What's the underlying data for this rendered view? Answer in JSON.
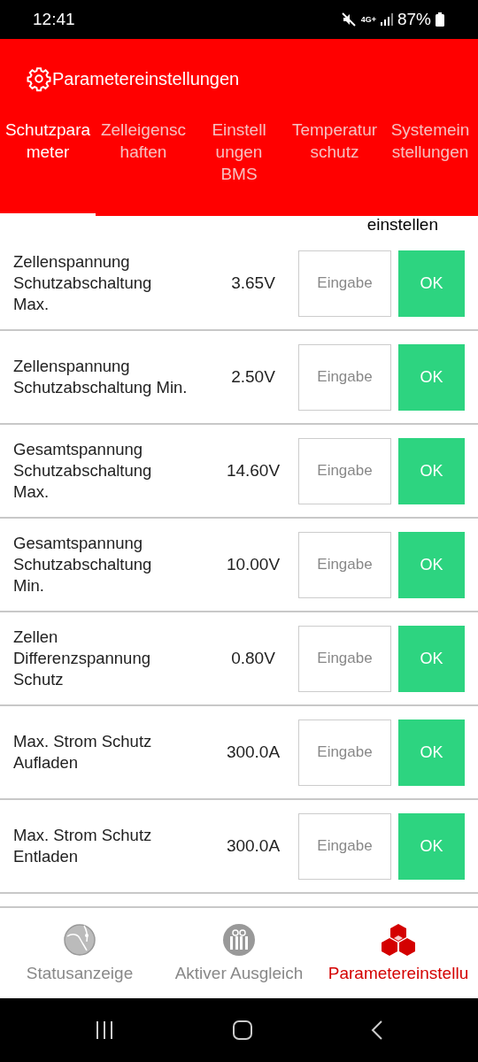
{
  "status_bar": {
    "time": "12:41",
    "network": "4G+",
    "battery": "87%"
  },
  "header": {
    "title": "Parametereinstellungen"
  },
  "tabs": [
    {
      "label": "Schutzpara\nmeter",
      "selected": true
    },
    {
      "label": "Zelleigensc\nhaften",
      "selected": false
    },
    {
      "label": "Einstell\nungen\nBMS",
      "selected": false
    },
    {
      "label": "Temperatur\nschutz",
      "selected": false
    },
    {
      "label": "Systemein\nstellungen",
      "selected": false
    }
  ],
  "cut_row_text": "einstellen",
  "rows": [
    {
      "label": "Zellenspannung\nSchutzabschaltung\nMax.",
      "value": "3.65V",
      "placeholder": "Eingabe",
      "button": "OK"
    },
    {
      "label": "Zellenspannung\nSchutzabschaltung Min.",
      "value": "2.50V",
      "placeholder": "Eingabe",
      "button": "OK"
    },
    {
      "label": "Gesamtspannung\nSchutzabschaltung\nMax.",
      "value": "14.60V",
      "placeholder": "Eingabe",
      "button": "OK"
    },
    {
      "label": "Gesamtspannung\nSchutzabschaltung\nMin.",
      "value": "10.00V",
      "placeholder": "Eingabe",
      "button": "OK"
    },
    {
      "label": "Zellen\nDifferenzspannung\nSchutz",
      "value": "0.80V",
      "placeholder": "Eingabe",
      "button": "OK"
    },
    {
      "label": "Max. Strom Schutz\nAufladen",
      "value": "300.0A",
      "placeholder": "Eingabe",
      "button": "OK"
    },
    {
      "label": "Max. Strom Schutz\nEntladen",
      "value": "300.0A",
      "placeholder": "Eingabe",
      "button": "OK"
    }
  ],
  "bottom_nav": [
    {
      "kind": "globe",
      "label": "Statusanzeige",
      "selected": false
    },
    {
      "kind": "gift",
      "label": "Aktiver Ausgleich",
      "selected": false
    },
    {
      "kind": "cubes",
      "label": "Parametereinstellu",
      "selected": true
    }
  ]
}
